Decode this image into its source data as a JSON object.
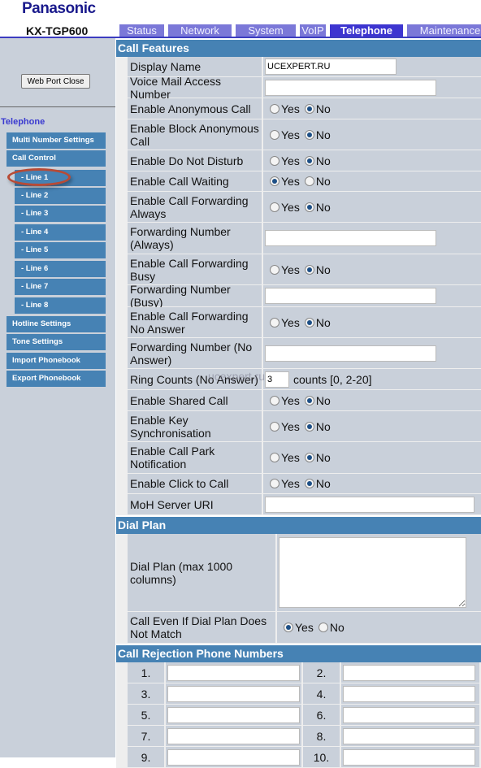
{
  "header": {
    "logo": "Panasonic",
    "model": "KX-TGP600",
    "tabs": [
      {
        "label": "Status",
        "active": false
      },
      {
        "label": "Network",
        "active": false
      },
      {
        "label": "System",
        "active": false
      },
      {
        "label": "VoIP",
        "active": false
      },
      {
        "label": "Telephone",
        "active": true
      },
      {
        "label": "Maintenance",
        "active": false
      }
    ]
  },
  "sidebar": {
    "web_port_close": "Web Port Close",
    "title": "Telephone",
    "items": [
      {
        "label": "Multi Number Settings",
        "sub": false
      },
      {
        "label": "Call Control",
        "sub": false
      },
      {
        "label": "- Line 1",
        "sub": true,
        "highlighted": true
      },
      {
        "label": "- Line 2",
        "sub": true
      },
      {
        "label": "- Line 3",
        "sub": true
      },
      {
        "label": "- Line 4",
        "sub": true
      },
      {
        "label": "- Line 5",
        "sub": true
      },
      {
        "label": "- Line 6",
        "sub": true
      },
      {
        "label": "- Line 7",
        "sub": true
      },
      {
        "label": "- Line 8",
        "sub": true
      },
      {
        "label": "Hotline Settings",
        "sub": false
      },
      {
        "label": "Tone Settings",
        "sub": false
      },
      {
        "label": "Import Phonebook",
        "sub": false
      },
      {
        "label": "Export Phonebook",
        "sub": false
      }
    ]
  },
  "watermark": "ucexpert.ru",
  "call_features": {
    "title": "Call Features",
    "yes": "Yes",
    "no": "No",
    "rows": [
      {
        "label": "Display Name",
        "type": "text",
        "value": "UCEXPERT.RU",
        "width": 162
      },
      {
        "label": "Voice Mail Access Number",
        "type": "text",
        "value": "",
        "width": 211
      },
      {
        "label": "Enable Anonymous Call",
        "type": "radio",
        "value": "No"
      },
      {
        "label": "Enable Block Anonymous Call",
        "type": "radio",
        "value": "No"
      },
      {
        "label": "Enable Do Not Disturb",
        "type": "radio",
        "value": "No"
      },
      {
        "label": "Enable Call Waiting",
        "type": "radio",
        "value": "Yes"
      },
      {
        "label": "Enable Call Forwarding Always",
        "type": "radio",
        "value": "No"
      },
      {
        "label": "Forwarding Number (Always)",
        "type": "text",
        "value": "",
        "width": 211
      },
      {
        "label": "Enable Call Forwarding Busy",
        "type": "radio",
        "value": "No"
      },
      {
        "label": "Forwarding Number (Busy)",
        "type": "text",
        "value": "",
        "width": 211
      },
      {
        "label": "Enable Call Forwarding No Answer",
        "type": "radio",
        "value": "No"
      },
      {
        "label": "Forwarding Number (No Answer)",
        "type": "text",
        "value": "",
        "width": 211
      },
      {
        "label": "Ring Counts (No Answer)",
        "type": "count",
        "value": "3",
        "suffix": "counts [0, 2-20]"
      },
      {
        "label": "Enable Shared Call",
        "type": "radio",
        "value": "No"
      },
      {
        "label": "Enable Key Synchronisation",
        "type": "radio",
        "value": "No"
      },
      {
        "label": "Enable Call Park Notification",
        "type": "radio",
        "value": "No"
      },
      {
        "label": "Enable Click to Call",
        "type": "radio",
        "value": "No"
      },
      {
        "label": "MoH Server URI",
        "type": "text",
        "value": "",
        "width": 258
      }
    ]
  },
  "dial_plan": {
    "title": "Dial Plan",
    "label": "Dial Plan (max 1000 columns)",
    "value": "",
    "call_even_label": "Call Even If Dial Plan Does Not Match",
    "call_even_value": "Yes"
  },
  "rejection": {
    "title": "Call Rejection Phone Numbers",
    "numbers": [
      "1.",
      "2.",
      "3.",
      "4.",
      "5.",
      "6.",
      "7.",
      "8.",
      "9.",
      "10."
    ]
  }
}
